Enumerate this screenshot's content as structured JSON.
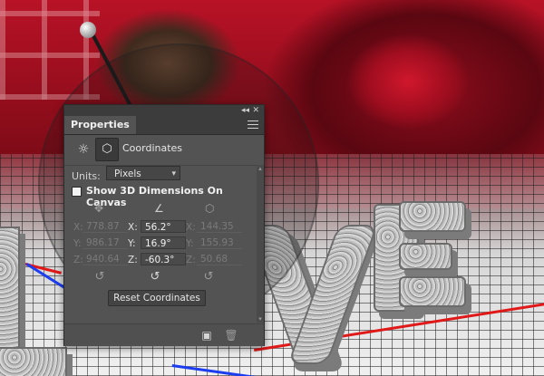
{
  "panel": {
    "title": "Properties",
    "collapse_glyph": "◂◂",
    "close_glyph": "✕",
    "menu_icon": "hamburger-icon",
    "mode_label": "Coordinates",
    "units_label": "Units:",
    "units_value": "Pixels",
    "show_dims_label": "Show 3D Dimensions On Canvas",
    "reset_label": "Reset Coordinates",
    "position": {
      "x_label": "X:",
      "x_value": "778.87",
      "y_label": "Y:",
      "y_value": "986.17",
      "z_label": "Z:",
      "z_value": "940.64"
    },
    "rotation": {
      "x_label": "X:",
      "x_value": "56.2°",
      "y_label": "Y:",
      "y_value": "16.9°",
      "z_label": "Z:",
      "z_value": "-60.3°"
    },
    "scale": {
      "x_label": "X:",
      "x_value": "144.35",
      "y_label": "Y:",
      "y_value": "155.93",
      "z_label": "Z:",
      "z_value": "50.68"
    }
  },
  "colors": {
    "panel_bg": "#535353",
    "axis_red": "#e01818",
    "axis_blue": "#1c3cf0"
  }
}
